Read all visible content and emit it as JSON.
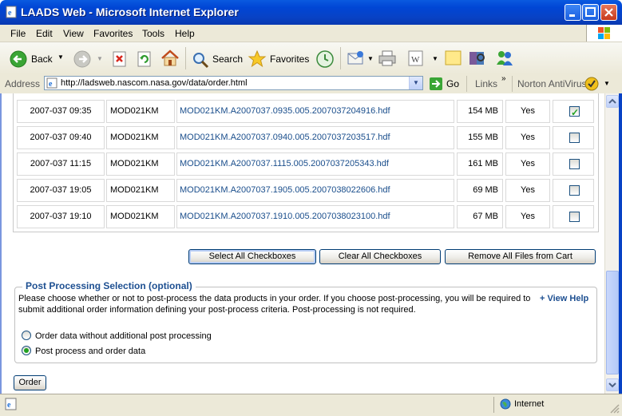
{
  "window": {
    "title": "LAADS Web - Microsoft Internet Explorer"
  },
  "menu": [
    "File",
    "Edit",
    "View",
    "Favorites",
    "Tools",
    "Help"
  ],
  "toolbar": {
    "back": "Back",
    "search": "Search",
    "favorites": "Favorites"
  },
  "address": {
    "label": "Address",
    "url": "http://ladsweb.nascom.nasa.gov/data/order.html",
    "go": "Go",
    "links": "Links",
    "norton": "Norton AntiVirus"
  },
  "table": {
    "rows": [
      {
        "date": "2007-037 09:35",
        "product": "MOD021KM",
        "file": "MOD021KM.A2007037.0935.005.2007037204916.hdf",
        "size": "154 MB",
        "avail": "Yes",
        "checked": true
      },
      {
        "date": "2007-037 09:40",
        "product": "MOD021KM",
        "file": "MOD021KM.A2007037.0940.005.2007037203517.hdf",
        "size": "155 MB",
        "avail": "Yes",
        "checked": false
      },
      {
        "date": "2007-037 11:15",
        "product": "MOD021KM",
        "file": "MOD021KM.A2007037.1115.005.2007037205343.hdf",
        "size": "161 MB",
        "avail": "Yes",
        "checked": false
      },
      {
        "date": "2007-037 19:05",
        "product": "MOD021KM",
        "file": "MOD021KM.A2007037.1905.005.2007038022606.hdf",
        "size": "69 MB",
        "avail": "Yes",
        "checked": false
      },
      {
        "date": "2007-037 19:10",
        "product": "MOD021KM",
        "file": "MOD021KM.A2007037.1910.005.2007038023100.hdf",
        "size": "67 MB",
        "avail": "Yes",
        "checked": false
      }
    ]
  },
  "buttons": {
    "select_all": "Select All Checkboxes",
    "clear_all": "Clear All Checkboxes",
    "remove_all": "Remove All Files from Cart",
    "order": "Order"
  },
  "post": {
    "legend": "Post Processing Selection (optional)",
    "desc1": "Please choose whether or not to post-process the data products in your order. If you choose post-processing, you will be required to",
    "desc2": "submit additional order information defining your post-process criteria. Post-processing is not required.",
    "view_help": "+ View Help",
    "opt1": "Order data without additional post processing",
    "opt2": "Post process and order data",
    "selected": 2
  },
  "status": {
    "zone": "Internet"
  },
  "colors": {
    "titlebar": "#0046d5",
    "link": "#1a4e8c",
    "legend": "#1d4f91",
    "check": "#21a121"
  }
}
